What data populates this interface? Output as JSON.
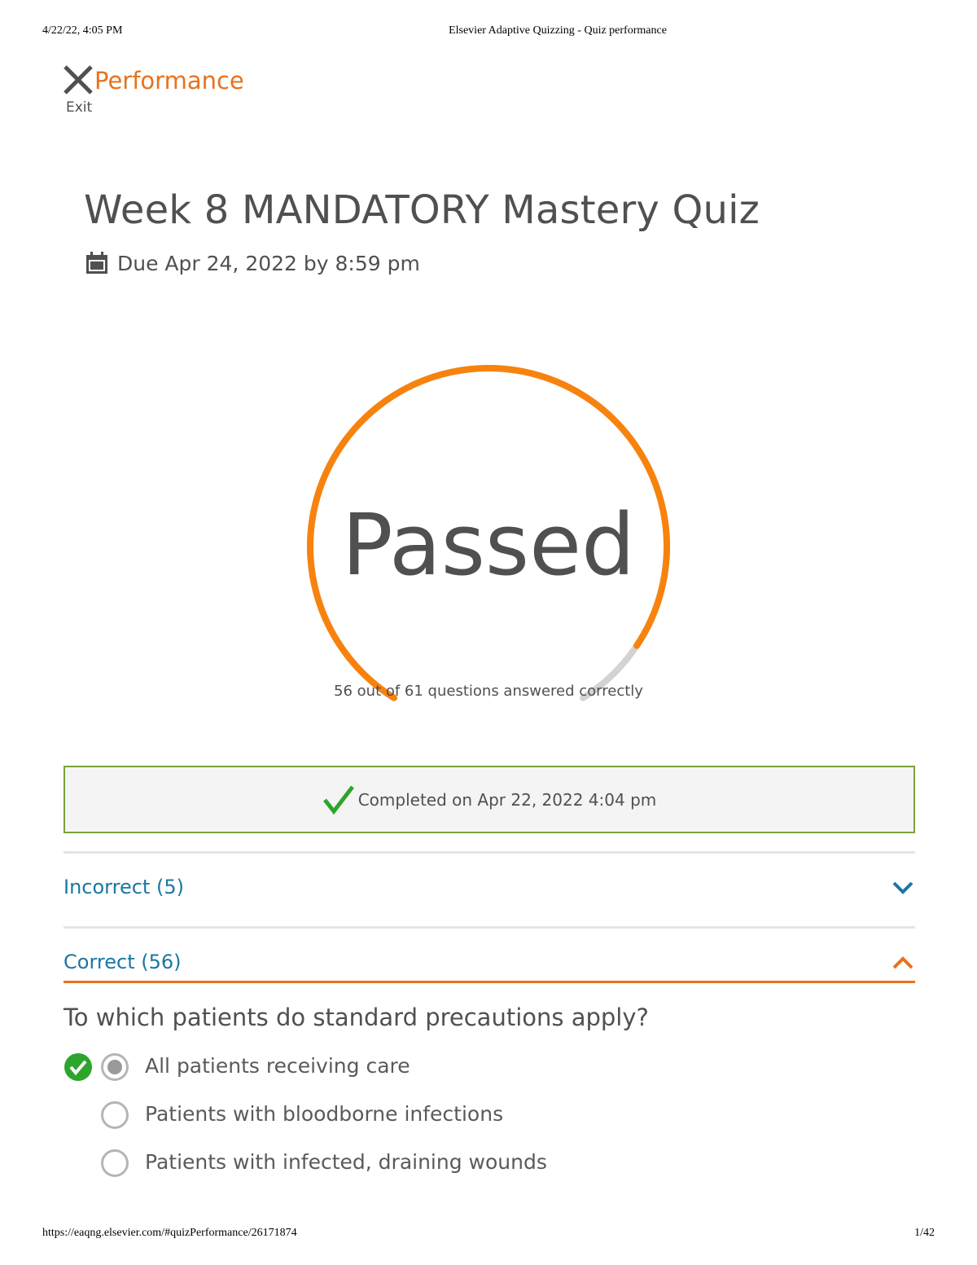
{
  "print_header": {
    "datetime": "4/22/22, 4:05 PM",
    "page_title": "Elsevier Adaptive Quizzing - Quiz performance"
  },
  "header": {
    "exit_label": "Exit",
    "title": "Performance",
    "accent_color": "#e9711c"
  },
  "quiz": {
    "title": "Week 8 MANDATORY Mastery Quiz",
    "due": "Due Apr 24, 2022 by 8:59 pm"
  },
  "result": {
    "status": "Passed",
    "caption": "56 out of 61 questions answered correctly",
    "correct": 56,
    "total": 61,
    "arc_color": "#f7830e",
    "track_color": "#d3d3d3"
  },
  "completion": {
    "text": "Completed on Apr 22, 2022 4:04 pm",
    "border_color": "#7aa23c"
  },
  "sections": {
    "incorrect": {
      "label": "Incorrect (5)",
      "expanded": false
    },
    "correct": {
      "label": "Correct (56)",
      "expanded": true
    }
  },
  "question": {
    "text": "To which patients do standard precautions apply?",
    "options": [
      {
        "label": "All patients receiving care",
        "selected": true,
        "correct": true
      },
      {
        "label": "Patients with bloodborne infections",
        "selected": false
      },
      {
        "label": "Patients with infected, draining wounds",
        "selected": false
      }
    ]
  },
  "print_footer": {
    "url": "https://eaqng.elsevier.com/#quizPerformance/26171874",
    "page": "1/42"
  },
  "icons": {
    "exit": "close-icon",
    "due": "calendar-icon",
    "completed": "checkmark-icon",
    "incorrect_toggle": "chevron-down-icon",
    "correct_toggle": "chevron-up-icon",
    "answer_correct": "check-circle-icon",
    "radio": "radio-icon"
  }
}
